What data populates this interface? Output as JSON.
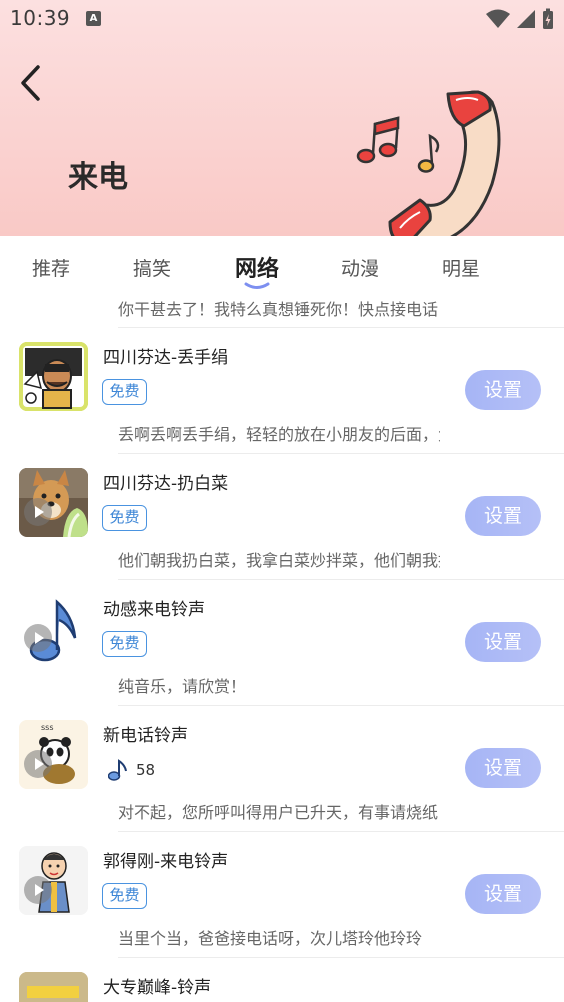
{
  "status_bar": {
    "time": "10:39",
    "a_icon": "A"
  },
  "header": {
    "title": "来电"
  },
  "tabs": [
    {
      "label": "推荐"
    },
    {
      "label": "搞笑"
    },
    {
      "label": "网络"
    },
    {
      "label": "动漫"
    },
    {
      "label": "明星"
    }
  ],
  "partial_desc": "你干甚去了！我特么真想锤死你！快点接电话",
  "items": [
    {
      "title": "四川芬达-丢手绢",
      "badge": "免费",
      "button": "设置",
      "desc": "丢啊丢啊丢手绢，轻轻的放在小朋友的后面，大家不要告诉他"
    },
    {
      "title": "四川芬达-扔白菜",
      "badge": "免费",
      "button": "设置",
      "desc": "他们朝我扔白菜，我拿白菜炒拌菜，他们朝我扔"
    },
    {
      "title": "动感来电铃声",
      "badge": "免费",
      "button": "设置",
      "desc": "纯音乐，请欣赏！"
    },
    {
      "title": "新电话铃声",
      "count": "58",
      "button": "设置",
      "desc": "对不起，您所呼叫得用户已升天，有事请烧纸"
    },
    {
      "title": "郭得刚-来电铃声",
      "badge": "免费",
      "button": "设置",
      "desc": "当里个当，爸爸接电话呀，次儿塔玲他玲玲"
    },
    {
      "title": "大专巅峰-铃声"
    }
  ],
  "colors": {
    "accent_blue": "#4a93e0",
    "button": "#a6b5f5",
    "header_pink": "#f9c9c6"
  }
}
